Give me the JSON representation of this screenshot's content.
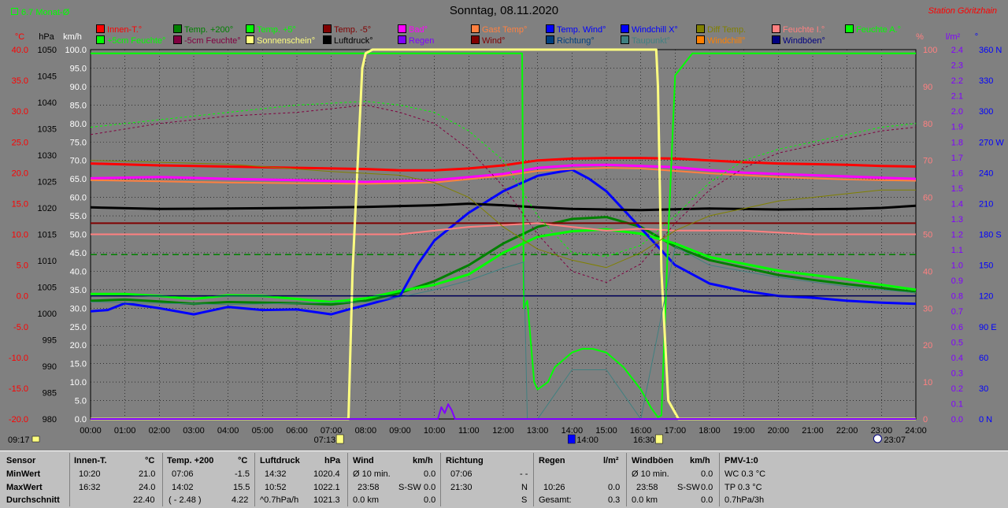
{
  "header": {
    "monat_label": "6.7 Monat-Ø",
    "title": "Sonntag, 08.11.2020",
    "station": "Station Göritzhain"
  },
  "colors": {
    "background": "#808080",
    "grid": "#000000",
    "temp_axis": "#ff0000",
    "pressure_axis": "#000000",
    "wind_axis": "#ffffff",
    "percent_axis": "#ff8080",
    "rain_axis": "#8000ff",
    "direction_axis": "#0000ff"
  },
  "axes": {
    "temp": {
      "unit": "°C",
      "ticks": [
        "40.0",
        "35.0",
        "30.0",
        "25.0",
        "20.0",
        "15.0",
        "10.0",
        "5.0",
        "0.0",
        "-5.0",
        "-10.0",
        "-15.0",
        "-20.0"
      ],
      "range": [
        -20,
        40
      ]
    },
    "pressure": {
      "unit": "hPa",
      "ticks": [
        "1050",
        "1045",
        "1040",
        "1035",
        "1030",
        "1025",
        "1020",
        "1015",
        "1010",
        "1005",
        "1000",
        "995",
        "990",
        "985",
        "980"
      ],
      "range": [
        980,
        1050
      ]
    },
    "wind": {
      "unit": "km/h",
      "ticks": [
        "100.0",
        "95.0",
        "90.0",
        "85.0",
        "80.0",
        "75.0",
        "70.0",
        "65.0",
        "60.0",
        "55.0",
        "50.0",
        "45.0",
        "40.0",
        "35.0",
        "30.0",
        "25.0",
        "20.0",
        "15.0",
        "10.0",
        "5.0",
        "0.0"
      ],
      "range": [
        0,
        100
      ]
    },
    "percent": {
      "unit": "%",
      "ticks": [
        "100",
        "90",
        "80",
        "70",
        "60",
        "50",
        "40",
        "30",
        "20",
        "10",
        "0"
      ],
      "range": [
        0,
        100
      ]
    },
    "rain": {
      "unit": "l/m²",
      "ticks": [
        "2.4",
        "2.3",
        "2.2",
        "2.1",
        "2.0",
        "1.9",
        "1.8",
        "1.7",
        "1.6",
        "1.5",
        "1.4",
        "1.3",
        "1.2",
        "1.1",
        "1.0",
        "0.9",
        "0.8",
        "0.7",
        "0.6",
        "0.5",
        "0.4",
        "0.3",
        "0.2",
        "0.1",
        "0.0"
      ],
      "range": [
        0,
        2.5
      ]
    },
    "direction": {
      "unit": "°",
      "ticks": [
        "360 N",
        "330",
        "300",
        "270 W",
        "240",
        "210",
        "180 S",
        "150",
        "120",
        "90 E",
        "60",
        "30",
        "0 N"
      ],
      "range": [
        0,
        360
      ]
    },
    "time": {
      "ticks": [
        "00:00",
        "01:00",
        "02:00",
        "03:00",
        "04:00",
        "05:00",
        "06:00",
        "07:00",
        "08:00",
        "09:00",
        "10:00",
        "11:00",
        "12:00",
        "13:00",
        "14:00",
        "15:00",
        "16:00",
        "17:00",
        "18:00",
        "19:00",
        "20:00",
        "21:00",
        "22:00",
        "23:00",
        "24:00"
      ]
    }
  },
  "time_markers": {
    "left": "09:17",
    "sunrise": "07:13",
    "noon": "14:00",
    "sunset": "16:30",
    "moon": "23:07"
  },
  "legend": [
    {
      "label": "Innen-T.°",
      "color": "#ff0000"
    },
    {
      "label": "Temp. +200°",
      "color": "#008000"
    },
    {
      "label": "Temp. +5°",
      "color": "#00ff00"
    },
    {
      "label": "Temp. -5°",
      "color": "#800000"
    },
    {
      "label": "Bad°",
      "color": "#ff00ff"
    },
    {
      "label": "Gast Temp°",
      "color": "#ff8040"
    },
    {
      "label": "Temp. Wind°",
      "color": "#0000ff"
    },
    {
      "label": "Windchill X°",
      "color": "#0000ff"
    },
    {
      "label": "Diff Temp.",
      "color": "#808000"
    },
    {
      "label": "Feuchte I.°",
      "color": "#ff8080"
    },
    {
      "label": "Feuchte A.°",
      "color": "#00ff00"
    },
    {
      "label": "+5cm Feuchte°",
      "color": "#00ff00"
    },
    {
      "label": "-5cm Feuchte°",
      "color": "#800040"
    },
    {
      "label": "Sonnenschein°",
      "color": "#ffff80"
    },
    {
      "label": "Luftdruck°",
      "color": "#000000"
    },
    {
      "label": "Regen",
      "color": "#8000ff"
    },
    {
      "label": "Wind°",
      "color": "#800000"
    },
    {
      "label": "Richtung°",
      "color": "#004080"
    },
    {
      "label": "Taupunkt°",
      "color": "#408080"
    },
    {
      "label": "Windchill°",
      "color": "#ff8000"
    },
    {
      "label": "Windböen°",
      "color": "#000080"
    }
  ],
  "chart_data": {
    "type": "line",
    "title": "Sonntag, 08.11.2020",
    "xlabel": "",
    "xlim": [
      0,
      24
    ],
    "ylabel_left": "°C",
    "ylim_temp": [
      -20,
      40
    ],
    "grid": true,
    "legend_position": "top",
    "series": [
      {
        "name": "Innen-T.°",
        "color": "#ff0000",
        "axis": "temp",
        "width": 3,
        "x": [
          0,
          2,
          4,
          6,
          7,
          8,
          9,
          10,
          11,
          12,
          13,
          14,
          15,
          16,
          17,
          18,
          19,
          20,
          21,
          22,
          23,
          24
        ],
        "y": [
          21.5,
          21.2,
          21.0,
          20.8,
          20.7,
          20.6,
          20.4,
          20.4,
          20.7,
          21.2,
          22.0,
          22.3,
          22.4,
          22.4,
          22.3,
          22.0,
          21.7,
          21.5,
          21.4,
          21.3,
          21.1,
          21.0
        ]
      },
      {
        "name": "Temp. +200°",
        "color": "#008000",
        "axis": "temp",
        "width": 3,
        "x": [
          0,
          1,
          2,
          3,
          4,
          5,
          6,
          7,
          8,
          9,
          10,
          11,
          12,
          13,
          14,
          15,
          16,
          17,
          18,
          19,
          20,
          21,
          22,
          23,
          24
        ],
        "y": [
          -0.8,
          -0.6,
          -0.9,
          -1.3,
          -1.0,
          -1.1,
          -1.2,
          -1.4,
          -0.8,
          0.5,
          2.4,
          5.0,
          8.5,
          11.2,
          12.5,
          12.8,
          11.2,
          8.0,
          5.8,
          4.6,
          3.4,
          2.6,
          1.9,
          1.3,
          0.6
        ]
      },
      {
        "name": "Temp. +5°",
        "color": "#00ff00",
        "axis": "temp",
        "width": 3,
        "x": [
          0,
          1,
          2,
          3,
          4,
          5,
          6,
          7,
          8,
          9,
          10,
          11,
          12,
          13,
          14,
          15,
          16,
          17,
          18,
          19,
          20,
          21,
          22,
          23,
          24
        ],
        "y": [
          0.3,
          0.3,
          0.0,
          -0.5,
          0.1,
          0.0,
          -0.5,
          -1.0,
          -0.4,
          0.8,
          1.8,
          3.5,
          7.0,
          9.6,
          10.5,
          10.8,
          10.1,
          8.5,
          6.3,
          5.2,
          4.1,
          3.4,
          2.7,
          1.8,
          1.0
        ]
      },
      {
        "name": "Temp. Wind°",
        "color": "#0000ff",
        "axis": "temp",
        "width": 3,
        "x": [
          0,
          0.5,
          1,
          2,
          3,
          4,
          5,
          6,
          7,
          7.5,
          8,
          9,
          9.5,
          10,
          11,
          12,
          13,
          14,
          14.5,
          15,
          16,
          17,
          18,
          19,
          20,
          21,
          22,
          23,
          24
        ],
        "y": [
          -2.5,
          -2.3,
          -1.2,
          -2.0,
          -3.0,
          -1.8,
          -2.3,
          -2.2,
          -3.0,
          -2.2,
          -1.5,
          0.0,
          5.0,
          9.0,
          13.5,
          17.0,
          19.5,
          20.5,
          19.0,
          17.0,
          11.0,
          5.0,
          2.0,
          0.8,
          0.0,
          -0.3,
          -0.8,
          -1.1,
          -1.3
        ]
      },
      {
        "name": "Bad°",
        "color": "#ff00ff",
        "axis": "temp",
        "width": 3,
        "x": [
          0,
          2,
          4,
          6,
          8,
          10,
          12,
          13,
          14,
          15,
          16,
          17,
          18,
          19,
          20,
          21,
          22,
          23,
          24
        ],
        "y": [
          19.1,
          19.3,
          19.0,
          18.8,
          18.5,
          18.8,
          19.8,
          20.8,
          21.2,
          21.3,
          21.1,
          20.9,
          20.4,
          20.0,
          19.8,
          19.6,
          19.4,
          19.2,
          19.0
        ]
      },
      {
        "name": "Gast Temp°",
        "color": "#ff8040",
        "axis": "temp",
        "width": 2,
        "x": [
          0,
          2,
          4,
          6,
          8,
          10,
          12,
          13,
          14,
          15,
          16,
          17,
          18,
          19,
          20,
          21,
          22,
          23,
          24
        ],
        "y": [
          18.8,
          18.6,
          18.4,
          18.3,
          18.2,
          18.4,
          19.5,
          20.3,
          20.6,
          20.8,
          20.7,
          20.3,
          19.9,
          19.6,
          19.3,
          19.1,
          18.9,
          18.8,
          18.7
        ]
      },
      {
        "name": "Luftdruck°",
        "color": "#000000",
        "axis": "pressure",
        "width": 3,
        "x": [
          0,
          2,
          4,
          6,
          8,
          10,
          11,
          12,
          13,
          14,
          16,
          18,
          20,
          22,
          23,
          24
        ],
        "y": [
          1020.1,
          1019.8,
          1019.9,
          1020.0,
          1020.2,
          1020.5,
          1020.8,
          1020.5,
          1020.1,
          1019.8,
          1019.6,
          1019.9,
          1019.7,
          1019.8,
          1020.0,
          1020.4
        ]
      },
      {
        "name": "Wind°",
        "color": "#800000",
        "axis": "wind",
        "width": 2,
        "x": [
          0,
          24
        ],
        "y": [
          53,
          53
        ]
      },
      {
        "name": "Feuchte I.°",
        "color": "#ff8080",
        "axis": "percent",
        "width": 2,
        "x": [
          0,
          4,
          7,
          9,
          10,
          11,
          12,
          13,
          14,
          15,
          16,
          17,
          18,
          19,
          20,
          21,
          22,
          23,
          24
        ],
        "y": [
          50,
          50,
          50,
          50,
          51,
          52,
          52.5,
          53,
          52,
          51,
          51.5,
          51,
          51,
          51,
          50.5,
          50,
          50,
          50,
          50
        ]
      },
      {
        "name": "Feuchte A.°",
        "color": "#00ff00",
        "axis": "percent",
        "width": 2,
        "x": [
          0,
          12.55,
          12.6,
          12.7,
          12.9,
          13,
          13.3,
          13.5,
          14,
          14.3,
          14.6,
          15,
          15.5,
          16,
          16.3,
          16.5,
          16.6,
          16.8,
          17,
          17.5,
          18,
          20,
          24
        ],
        "y": [
          99,
          99,
          30,
          32,
          10,
          8,
          10,
          14,
          18,
          19,
          19,
          18,
          14,
          8,
          3,
          0.5,
          1,
          50,
          93,
          99,
          99,
          99,
          99
        ]
      },
      {
        "name": "+5cm Feuchte°",
        "color": "#00ff00",
        "axis": "percent",
        "dash": "3,3",
        "width": 1,
        "x": [
          0,
          2,
          4,
          6,
          8,
          9,
          10,
          11,
          12,
          13,
          14,
          15,
          16,
          17,
          18,
          19,
          20,
          21,
          22,
          23,
          24
        ],
        "y": [
          79,
          81,
          83,
          85,
          86,
          85,
          83,
          78,
          70,
          55,
          45,
          44,
          47,
          55,
          64,
          70,
          73,
          75,
          77,
          79,
          80
        ]
      },
      {
        "name": "-5cm Feuchte°",
        "color": "#800040",
        "axis": "percent",
        "dash": "3,3",
        "width": 1,
        "x": [
          0,
          2,
          4,
          6,
          8,
          9,
          10,
          11,
          12,
          13,
          14,
          15,
          16,
          17,
          18,
          19,
          20,
          21,
          22,
          23,
          24
        ],
        "y": [
          77,
          80,
          82,
          83,
          85,
          83,
          80,
          73,
          63,
          50,
          40,
          37,
          42,
          53,
          62,
          68,
          72,
          74,
          76,
          78,
          79
        ]
      },
      {
        "name": "Sonnenschein°",
        "color": "#ffff80",
        "axis": "percent",
        "width": 3,
        "x": [
          0,
          7.5,
          7.62,
          7.9,
          8.0,
          8.2,
          16.45,
          16.5,
          16.6,
          16.8,
          17.1,
          24
        ],
        "y": [
          0,
          0,
          40,
          95,
          99,
          100,
          100,
          90,
          40,
          5,
          0,
          0
        ]
      },
      {
        "name": "Diff Temp.",
        "color": "#808000",
        "axis": "percent",
        "width": 1,
        "x": [
          0,
          4,
          7,
          9,
          10,
          11,
          12,
          13,
          14,
          15,
          16,
          17,
          18,
          19,
          20,
          21,
          22,
          23,
          24
        ],
        "y": [
          70,
          69,
          67,
          66,
          64,
          60,
          52,
          46,
          43,
          41,
          45,
          51,
          55,
          57,
          59,
          60,
          61,
          62,
          62
        ]
      },
      {
        "name": "Taupunkt°",
        "color": "#408080",
        "axis": "temp",
        "width": 1,
        "x": [
          0,
          4,
          8,
          9,
          10,
          11,
          12,
          12.6,
          12.7,
          13,
          14,
          15,
          16,
          17,
          18,
          20,
          22,
          24
        ],
        "y": [
          -1.0,
          -1.4,
          -1.0,
          -0.2,
          1.0,
          2.5,
          4.5,
          5.5,
          -20,
          -20,
          -12,
          -12,
          -20,
          8.0,
          5.0,
          3.0,
          1.5,
          0.5
        ]
      },
      {
        "name": "Windböen°",
        "color": "#000080",
        "axis": "temp",
        "width": 1,
        "x": [
          0,
          24
        ],
        "y": [
          0,
          0
        ]
      },
      {
        "name": "Regen",
        "color": "#8000ff",
        "axis": "rain",
        "width": 2,
        "x": [
          0,
          10.1,
          10.2,
          10.3,
          10.4,
          10.5,
          10.6,
          11,
          24
        ],
        "y": [
          0,
          0,
          0.08,
          0.04,
          0.1,
          0.06,
          0,
          0,
          0
        ]
      }
    ],
    "reference_lines": [
      {
        "name": "6.7 Monat-Ø",
        "axis": "temp",
        "value": 6.7,
        "color": "#008000",
        "dash": "8,5"
      },
      {
        "name": "0 °C",
        "axis": "temp",
        "value": 0,
        "color": "#000000"
      }
    ]
  },
  "stats_table": {
    "sensor": {
      "h": "Sensor",
      "rows": [
        "MinWert",
        "MaxWert",
        "Durchschnitt"
      ]
    },
    "innen": {
      "h": "Innen-T.",
      "u": "°C",
      "r1a": "10:20",
      "r1b": "21.0",
      "r2a": "16:32",
      "r2b": "24.0",
      "r3b": "22.40"
    },
    "temp200": {
      "h": "Temp. +200",
      "u": "°C",
      "r1a": "07:06",
      "r1b": "-1.5",
      "r2a": "14:02",
      "r2b": "15.5",
      "r3a": "( - 2.48 )",
      "r3b": "4.22"
    },
    "luft": {
      "h": "Luftdruck",
      "u": "hPa",
      "r1a": "14:32",
      "r1b": "1020.4",
      "r2a": "10:52",
      "r2b": "1022.1",
      "r3a": "^0.7hPa/h",
      "r3b": "1021.3"
    },
    "wind": {
      "h": "Wind",
      "u": "km/h",
      "r1a": "Ø 10 min.",
      "r1b": "0.0",
      "r2a": "23:58",
      "r2m": "S-SW",
      "r2b": "0.0",
      "r3a": "0.0 km",
      "r3b": "0.0"
    },
    "richtung": {
      "h": "Richtung",
      "r1a": "07:06",
      "r1b": "- -",
      "r2a": "21:30",
      "r2b": "N",
      "r3b": "S"
    },
    "regen": {
      "h": "Regen",
      "u": "l/m²",
      "r2a": "10:26",
      "r2b": "0.0",
      "r3a": "Gesamt:",
      "r3b": "0.3"
    },
    "boeen": {
      "h": "Windböen",
      "u": "km/h",
      "r1a": "Ø 10 min.",
      "r1b": "0.0",
      "r2a": "23:58",
      "r2m": "S-SW",
      "r2b": "0.0",
      "r3a": "0.0 km",
      "r3b": "0.0"
    },
    "pmv": {
      "h": "PMV-1:0",
      "r1": "WC 0.3 °C",
      "r2": "TP 0.3 °C",
      "r3": "0.7hPa/3h"
    }
  }
}
